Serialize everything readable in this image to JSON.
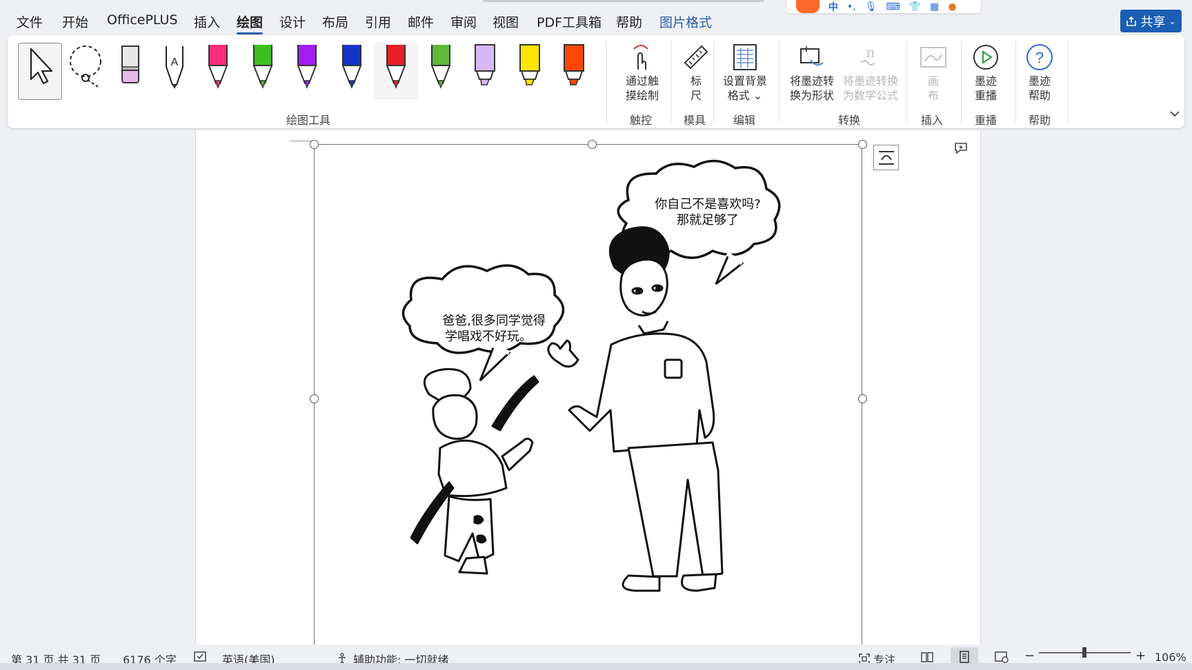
{
  "menu": {
    "tabs": [
      "文件",
      "开始",
      "OfficePLUS",
      "插入",
      "绘图",
      "设计",
      "布局",
      "引用",
      "邮件",
      "审阅",
      "视图",
      "PDF工具箱",
      "帮助",
      "图片格式"
    ],
    "active_tab": "绘图",
    "context_tab": "图片格式"
  },
  "share_button": {
    "label": "共享"
  },
  "ime_toolbar": {
    "mode_label": "中"
  },
  "ribbon": {
    "draw_tools_group": "绘图工具",
    "pens": [
      {
        "name": "pink-pen",
        "color": "#ff2d7a"
      },
      {
        "name": "green-pen",
        "color": "#3fbf1f"
      },
      {
        "name": "purple-pen",
        "color": "#a020f0"
      },
      {
        "name": "blue-pen",
        "color": "#1535c8"
      },
      {
        "name": "red-pen",
        "color": "#e8202a"
      },
      {
        "name": "green-pencil",
        "color": "#5fb83a"
      },
      {
        "name": "lavender-highlighter",
        "color": "#d7b7f5"
      },
      {
        "name": "yellow-highlighter",
        "color": "#ffe500"
      },
      {
        "name": "orange-highlighter",
        "color": "#ff4500"
      }
    ],
    "touch": {
      "button": "通过触\n摸绘制",
      "group": "触控"
    },
    "stencils": {
      "button": "标\n尺",
      "group": "模具"
    },
    "edit": {
      "button": "设置背景\n格式 ⌄",
      "group": "编辑"
    },
    "convert": {
      "button_shape": "将墨迹转\n换为形状",
      "button_math": "将墨迹转换\n为数学公式",
      "group": "转换"
    },
    "insert": {
      "button": "画\n布",
      "group": "插入"
    },
    "replay": {
      "button": "墨迹\n重播",
      "group": "重播"
    },
    "help": {
      "button": "墨迹\n帮助",
      "group": "帮助"
    }
  },
  "comic": {
    "bubble_father_line1": "你自己不是喜欢吗?",
    "bubble_father_line2": "那就足够了",
    "bubble_child_line1": "爸爸,很多同学觉得",
    "bubble_child_line2": "学唱戏不好玩。"
  },
  "statusbar": {
    "page": "第 31 页,共 31 页",
    "words": "6176 个字",
    "language": "英语(美国)",
    "accessibility": "辅助功能: 一切就绪",
    "focus": "专注",
    "zoom": "106%",
    "zoom_fraction": 0.48
  }
}
